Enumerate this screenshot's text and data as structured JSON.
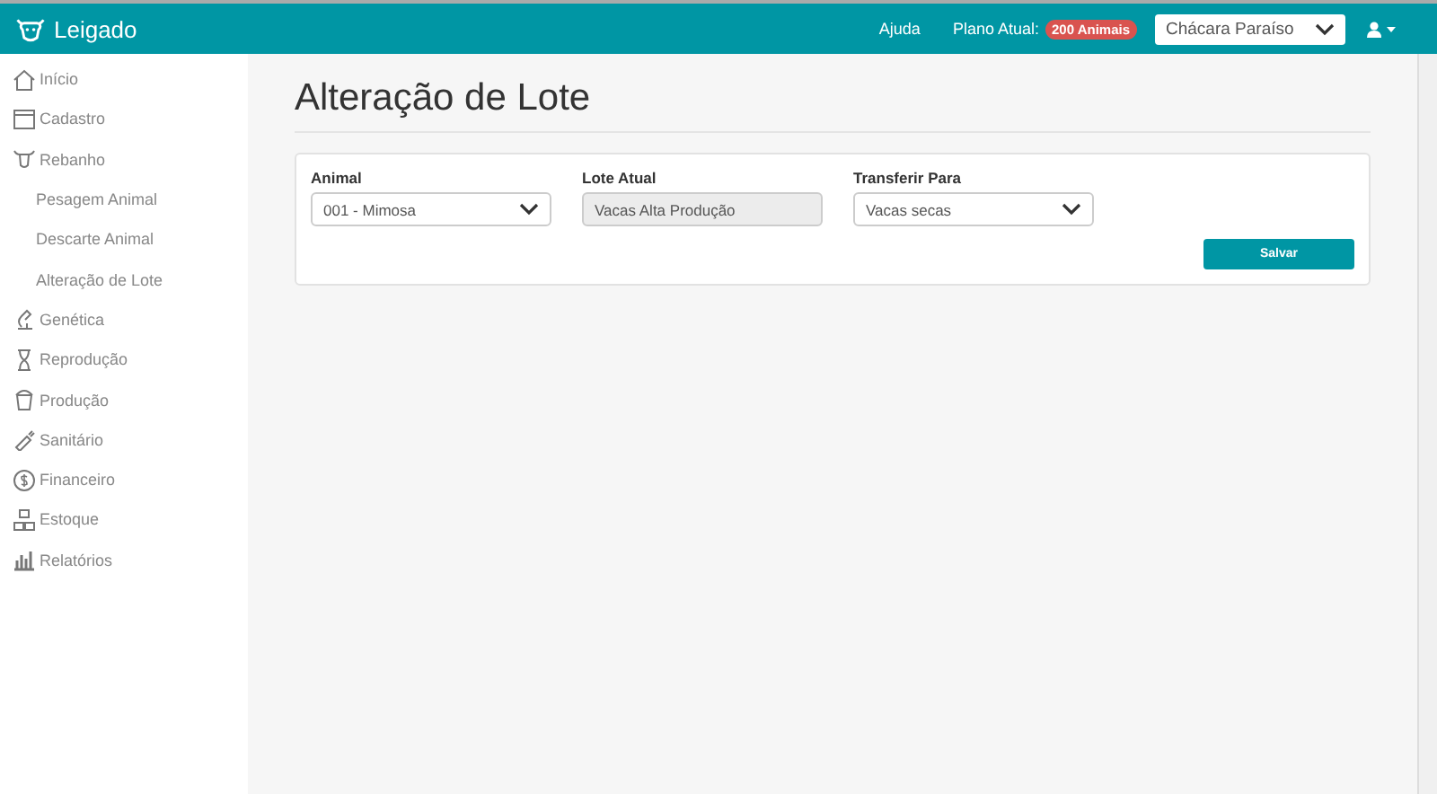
{
  "app": {
    "title": "Leigado"
  },
  "topbar": {
    "help": "Ajuda",
    "plan_label": "Plano Atual:",
    "plan_badge": "200 Animais",
    "farm_select": "Chácara Paraíso"
  },
  "sidebar": {
    "items": [
      {
        "label": "Início"
      },
      {
        "label": "Cadastro"
      },
      {
        "label": "Rebanho",
        "children": [
          {
            "label": "Pesagem Animal"
          },
          {
            "label": "Descarte Animal"
          },
          {
            "label": "Alteração de Lote"
          }
        ]
      },
      {
        "label": "Genética"
      },
      {
        "label": "Reprodução"
      },
      {
        "label": "Produção"
      },
      {
        "label": "Sanitário"
      },
      {
        "label": "Financeiro"
      },
      {
        "label": "Estoque"
      },
      {
        "label": "Relatórios"
      }
    ]
  },
  "page": {
    "title": "Alteração de Lote"
  },
  "form": {
    "fields": [
      {
        "kind": "select",
        "label": "Animal",
        "value": "001 - Mimosa"
      },
      {
        "kind": "readonly",
        "label": "Lote Atual",
        "value": "Vacas Alta Produção"
      },
      {
        "kind": "select",
        "label": "Transferir Para",
        "value": "Vacas secas"
      }
    ],
    "submit": "Salvar"
  }
}
